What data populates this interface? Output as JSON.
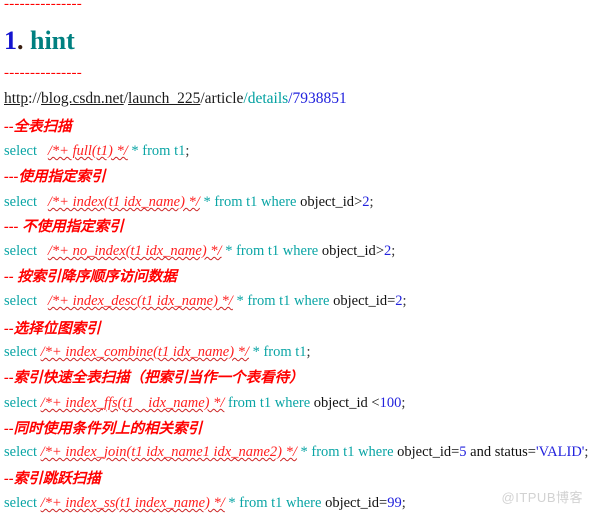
{
  "document": {
    "rule_top": "---------------",
    "rule_mid": "---------------",
    "heading": {
      "number": "1",
      "dot": ".",
      "word": "hint"
    },
    "url": {
      "scheme_host": "http",
      "sep1": "://",
      "host": "blog.csdn.net",
      "slash1": "/",
      "path1": "launch_225",
      "slash2": "/",
      "path2": "article",
      "slash3": "/",
      "path3": "details",
      "slash4": "/",
      "path4": "7938851",
      "full": "http://blog.csdn.net/launch_225/article/details/7938851"
    },
    "lines": [
      {
        "id": "comment-full-scan",
        "type": "comment",
        "text": "--全表扫描"
      },
      {
        "id": "sql-full",
        "type": "sql",
        "keyword": "select",
        "gap": "   ",
        "hint": "/*+ full(t1) */",
        "body": " * from t1",
        "tail": ";",
        "full": "select   /*+ full(t1) */ * from t1;"
      },
      {
        "id": "comment-use-index",
        "type": "comment",
        "text": "---使用指定索引"
      },
      {
        "id": "sql-index",
        "type": "sql",
        "keyword": "select",
        "gap": "   ",
        "hint": "/*+ index(t1 idx_name) */",
        "body": " * from t1 where ",
        "plain": "object_id",
        "operator": ">",
        "value": "2",
        "tail": ";",
        "full": "select   /*+ index(t1 idx_name) */ * from t1 where object_id>2;"
      },
      {
        "id": "comment-no-index",
        "type": "comment",
        "text": "--- 不使用指定索引"
      },
      {
        "id": "sql-no-index",
        "type": "sql",
        "keyword": "select",
        "gap": "   ",
        "hint": "/*+ no_index(t1 idx_name) */",
        "body": " * from t1 where ",
        "plain": "object_id",
        "operator": ">",
        "value": "2",
        "tail": ";",
        "full": "select   /*+ no_index(t1 idx_name) */ * from t1 where object_id>2;"
      },
      {
        "id": "comment-index-desc",
        "type": "comment",
        "text": "-- 按索引降序顺序访问数据"
      },
      {
        "id": "sql-index-desc",
        "type": "sql",
        "keyword": "select",
        "gap": "   ",
        "hint": "/*+ index_desc(t1 idx_name) */",
        "body": " * from t1 where ",
        "plain": "object_id",
        "operator": "=",
        "value": "2",
        "tail": ";",
        "full": "select   /*+ index_desc(t1 idx_name) */ * from t1 where object_id=2;"
      },
      {
        "id": "comment-index-combine",
        "type": "comment",
        "text": "--选择位图索引"
      },
      {
        "id": "sql-index-combine",
        "type": "sql",
        "keyword": "select",
        "gap": " ",
        "hint": "/*+ index_combine(t1 idx_name) */",
        "body": " * from t1",
        "tail": ";",
        "full": "select /*+ index_combine(t1 idx_name) */ * from t1;"
      },
      {
        "id": "comment-index-ffs",
        "type": "comment",
        "text": "--索引快速全表扫描（把索引当作一个表看待）"
      },
      {
        "id": "sql-index-ffs",
        "type": "sql",
        "keyword": "select",
        "gap": " ",
        "hint": "/*+ index_ffs(t1    idx_name) */",
        "body": " from t1 where ",
        "plain": "object_id ",
        "operator": "<",
        "value": "100",
        "tail": ";",
        "full": "select /*+ index_ffs(t1    idx_name) */ from t1 where object_id <100;"
      },
      {
        "id": "comment-index-join",
        "type": "comment",
        "text": "--同时使用条件列上的相关索引"
      },
      {
        "id": "sql-index-join",
        "type": "sql",
        "keyword": "select",
        "gap": " ",
        "hint": "/*+ index_join(t1 idx_name1 idx_name2) */",
        "body": " * from t1 where ",
        "plain": "object_id",
        "operator": "=",
        "value": "5",
        "plain2": " and status=",
        "string": "'VALID'",
        "tail": ";",
        "full": "select /*+ index_join(t1 idx_name1 idx_name2) */ * from t1 where object_id=5 and status='VALID';"
      },
      {
        "id": "comment-index-ss",
        "type": "comment",
        "text": "--索引跳跃扫描"
      },
      {
        "id": "sql-index-ss",
        "type": "sql",
        "keyword": "select",
        "gap": " ",
        "hint": "/*+ index_ss(t1 index_name) */",
        "body": " * from t1 where ",
        "plain": "object_id",
        "operator": "=",
        "value": "99",
        "tail": ";",
        "full": "select /*+ index_ss(t1 index_name) */ * from t1 where object_id=99;"
      }
    ],
    "watermark": "@ITPUB博客"
  }
}
